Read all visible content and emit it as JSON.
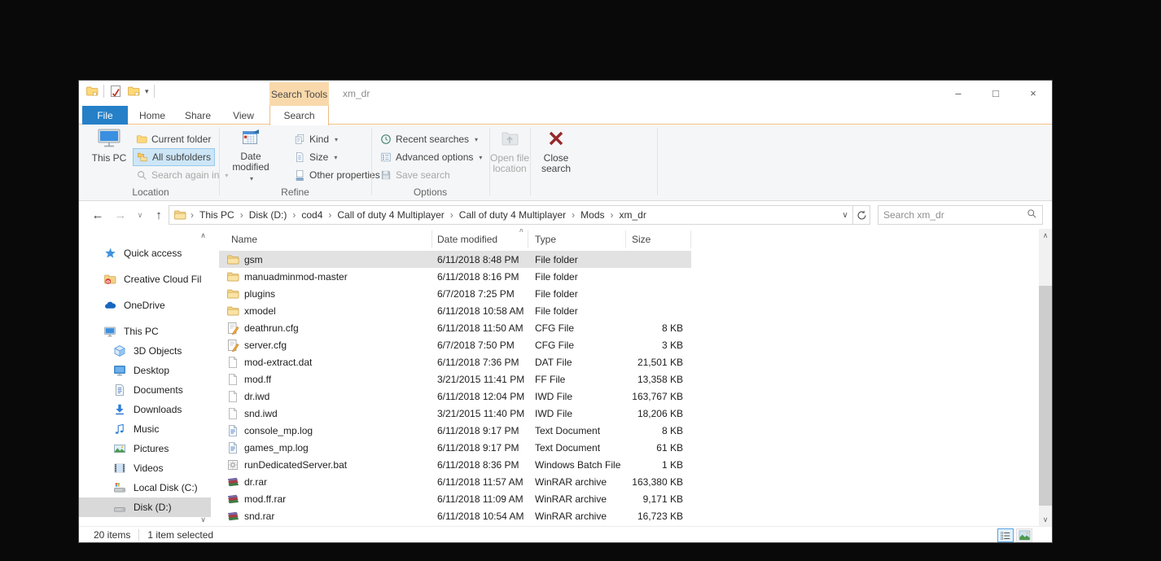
{
  "titlebar": {
    "search_tools": "Search Tools",
    "title": "xm_dr"
  },
  "tabs": {
    "file": "File",
    "home": "Home",
    "share": "Share",
    "view": "View",
    "search": "Search"
  },
  "ribbon": {
    "location": {
      "this_pc": "This PC",
      "current_folder": "Current folder",
      "all_subfolders": "All subfolders",
      "search_again": "Search again in",
      "label": "Location"
    },
    "refine": {
      "date_modified": "Date modified",
      "kind": "Kind",
      "size": "Size",
      "other_properties": "Other properties",
      "label": "Refine"
    },
    "options": {
      "recent_searches": "Recent searches",
      "advanced_options": "Advanced options",
      "save_search": "Save search",
      "label": "Options"
    },
    "open_file_location": "Open file location",
    "close_search": "Close search"
  },
  "navbar": {
    "breadcrumb": [
      "This PC",
      "Disk (D:)",
      "cod4",
      "Call of duty 4 Multiplayer",
      "Call of duty 4 Multiplayer",
      "Mods",
      "xm_dr"
    ],
    "search_placeholder": "Search xm_dr"
  },
  "sidebar": {
    "items": [
      {
        "label": "Quick access",
        "icon": "quick-access",
        "level": 0,
        "selected": false
      },
      {
        "label": "Creative Cloud Fil",
        "icon": "creative-cloud",
        "level": 0,
        "selected": false
      },
      {
        "label": "OneDrive",
        "icon": "onedrive",
        "level": 0,
        "selected": false
      },
      {
        "label": "This PC",
        "icon": "this-pc",
        "level": 0,
        "selected": false
      },
      {
        "label": "3D Objects",
        "icon": "objects-3d",
        "level": 1,
        "selected": false
      },
      {
        "label": "Desktop",
        "icon": "desktop",
        "level": 1,
        "selected": false
      },
      {
        "label": "Documents",
        "icon": "documents",
        "level": 1,
        "selected": false
      },
      {
        "label": "Downloads",
        "icon": "downloads",
        "level": 1,
        "selected": false
      },
      {
        "label": "Music",
        "icon": "music",
        "level": 1,
        "selected": false
      },
      {
        "label": "Pictures",
        "icon": "pictures",
        "level": 1,
        "selected": false
      },
      {
        "label": "Videos",
        "icon": "videos",
        "level": 1,
        "selected": false
      },
      {
        "label": "Local Disk (C:)",
        "icon": "disk-c",
        "level": 1,
        "selected": false
      },
      {
        "label": "Disk (D:)",
        "icon": "disk-d",
        "level": 1,
        "selected": true
      }
    ]
  },
  "filelist": {
    "columns": {
      "name": "Name",
      "date": "Date modified",
      "type": "Type",
      "size": "Size"
    },
    "rows": [
      {
        "name": "gsm",
        "date": "6/11/2018 8:48 PM",
        "type": "File folder",
        "size": "",
        "icon": "folder",
        "selected": true
      },
      {
        "name": "manuadminmod-master",
        "date": "6/11/2018 8:16 PM",
        "type": "File folder",
        "size": "",
        "icon": "folder",
        "selected": false
      },
      {
        "name": "plugins",
        "date": "6/7/2018 7:25 PM",
        "type": "File folder",
        "size": "",
        "icon": "folder",
        "selected": false
      },
      {
        "name": "xmodel",
        "date": "6/11/2018 10:58 AM",
        "type": "File folder",
        "size": "",
        "icon": "folder",
        "selected": false
      },
      {
        "name": "deathrun.cfg",
        "date": "6/11/2018 11:50 AM",
        "type": "CFG File",
        "size": "8 KB",
        "icon": "cfg",
        "selected": false
      },
      {
        "name": "server.cfg",
        "date": "6/7/2018 7:50 PM",
        "type": "CFG File",
        "size": "3 KB",
        "icon": "cfg",
        "selected": false
      },
      {
        "name": "mod-extract.dat",
        "date": "6/11/2018 7:36 PM",
        "type": "DAT File",
        "size": "21,501 KB",
        "icon": "file",
        "selected": false
      },
      {
        "name": "mod.ff",
        "date": "3/21/2015 11:41 PM",
        "type": "FF File",
        "size": "13,358 KB",
        "icon": "file",
        "selected": false
      },
      {
        "name": "dr.iwd",
        "date": "6/11/2018 12:04 PM",
        "type": "IWD File",
        "size": "163,767 KB",
        "icon": "file",
        "selected": false
      },
      {
        "name": "snd.iwd",
        "date": "3/21/2015 11:40 PM",
        "type": "IWD File",
        "size": "18,206 KB",
        "icon": "file",
        "selected": false
      },
      {
        "name": "console_mp.log",
        "date": "6/11/2018 9:17 PM",
        "type": "Text Document",
        "size": "8 KB",
        "icon": "log",
        "selected": false
      },
      {
        "name": "games_mp.log",
        "date": "6/11/2018 9:17 PM",
        "type": "Text Document",
        "size": "61 KB",
        "icon": "log",
        "selected": false
      },
      {
        "name": "runDedicatedServer.bat",
        "date": "6/11/2018 8:36 PM",
        "type": "Windows Batch File",
        "size": "1 KB",
        "icon": "bat",
        "selected": false
      },
      {
        "name": "dr.rar",
        "date": "6/11/2018 11:57 AM",
        "type": "WinRAR archive",
        "size": "163,380 KB",
        "icon": "rar",
        "selected": false
      },
      {
        "name": "mod.ff.rar",
        "date": "6/11/2018 11:09 AM",
        "type": "WinRAR archive",
        "size": "9,171 KB",
        "icon": "rar",
        "selected": false
      },
      {
        "name": "snd.rar",
        "date": "6/11/2018 10:54 AM",
        "type": "WinRAR archive",
        "size": "16,723 KB",
        "icon": "rar",
        "selected": false
      }
    ]
  },
  "statusbar": {
    "total": "20 items",
    "selected": "1 item selected"
  }
}
